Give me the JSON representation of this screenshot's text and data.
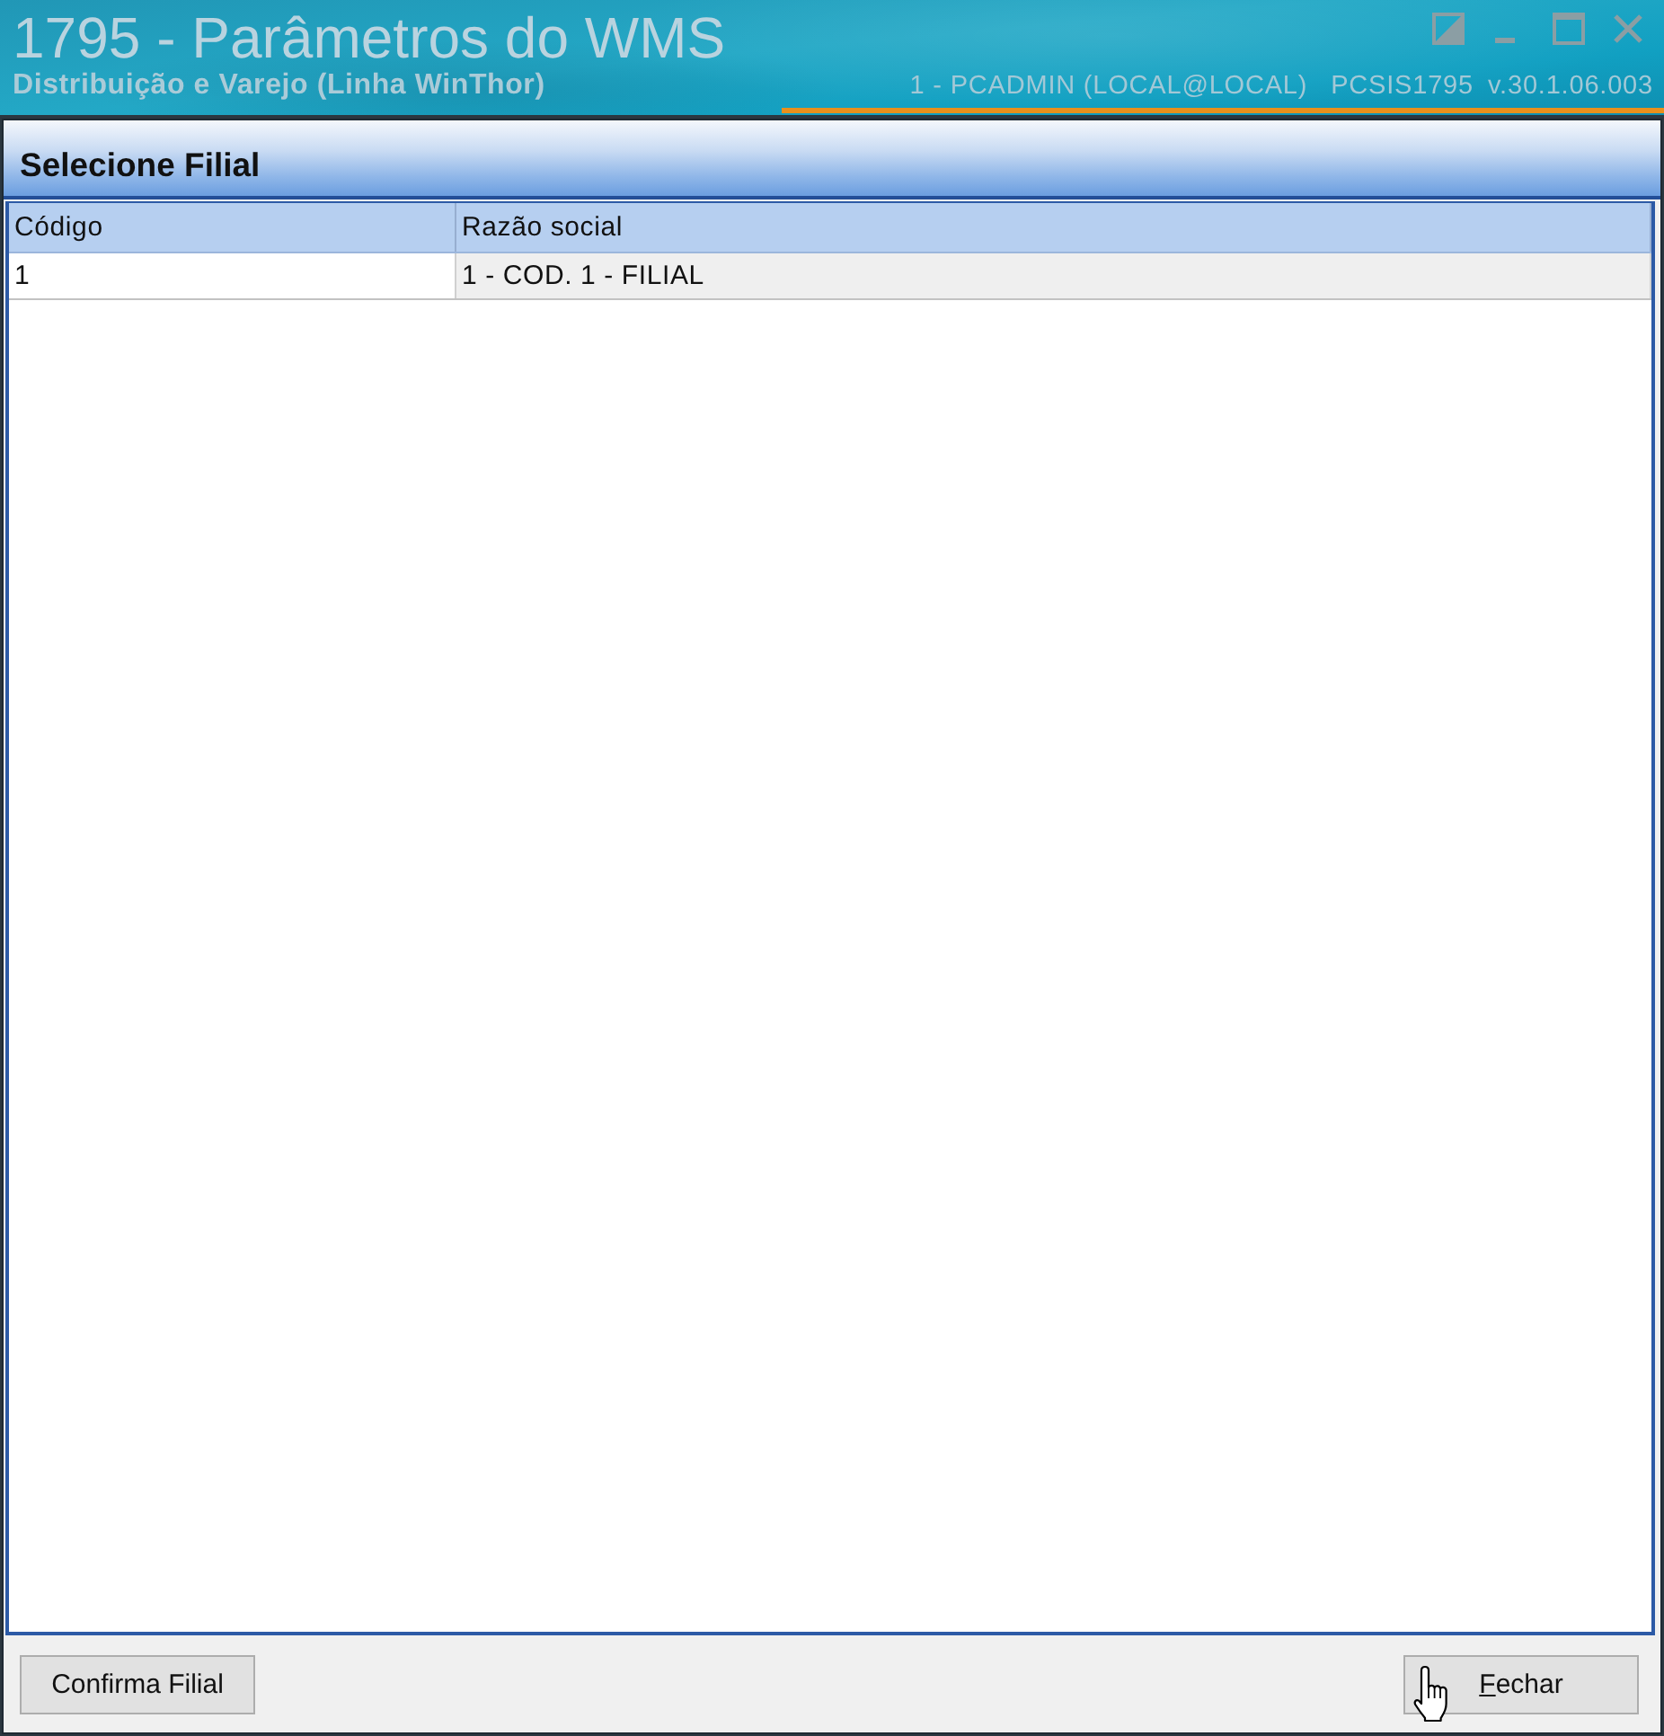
{
  "window": {
    "title": "1795 - Parâmetros do WMS",
    "subtitle": "Distribuição e Varejo (Linha WinThor)",
    "user_info": "1 - PCADMIN (LOCAL@LOCAL)",
    "program": "PCSIS1795",
    "version": "v.30.1.06.003"
  },
  "panel": {
    "title": "Selecione Filial"
  },
  "table": {
    "columns": [
      "Código",
      "Razão social"
    ],
    "rows": [
      [
        "1",
        "1 - COD. 1 - FILIAL"
      ]
    ]
  },
  "buttons": [
    {
      "label": "Confirma Filial",
      "mnemonic": false,
      "hovered": false
    },
    {
      "label": "Fechar",
      "mnemonic": true,
      "hovered": true
    }
  ]
}
